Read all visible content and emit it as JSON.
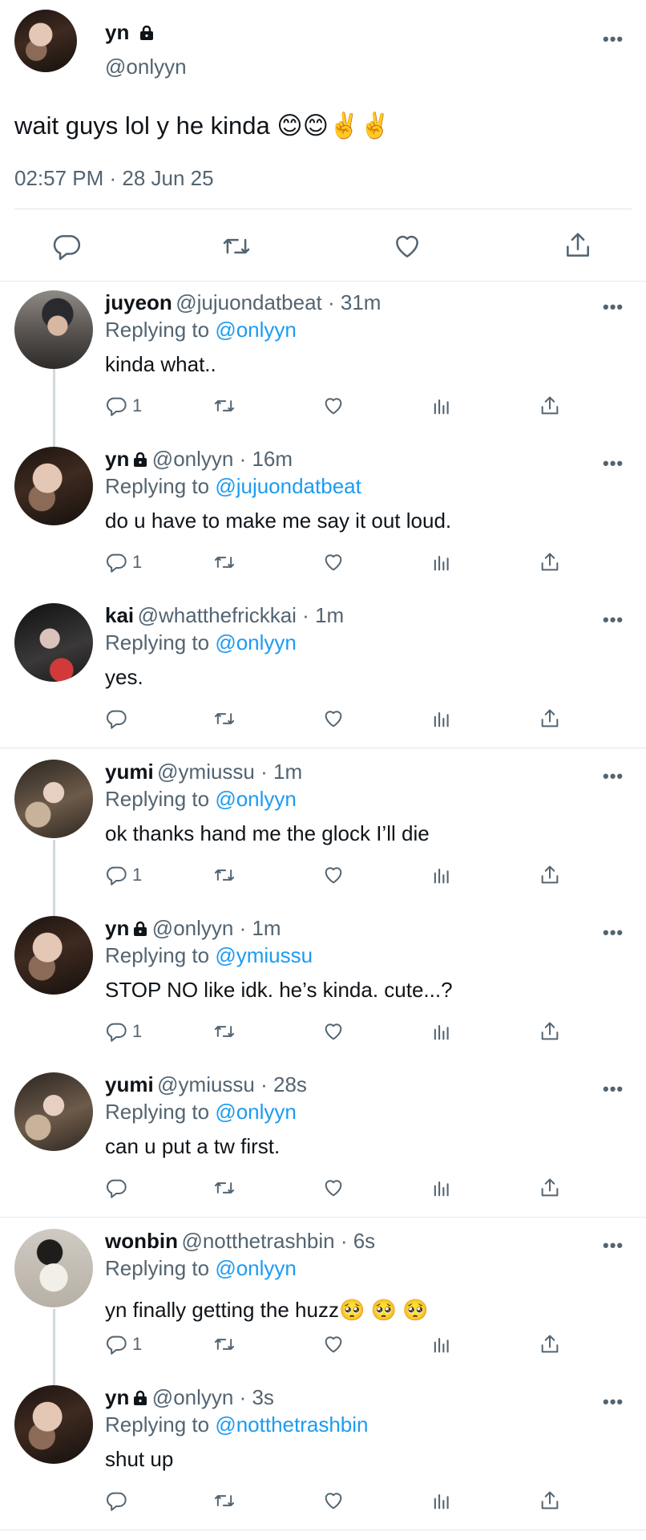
{
  "main_tweet": {
    "name": "yn",
    "handle": "@onlyyn",
    "text": "wait guys lol y he kinda 😊😊✌️✌️",
    "timestamp": "02:57 PM · 28 Jun 25",
    "more": "•••"
  },
  "replies": [
    {
      "name": "juyeon",
      "meta": "@jujuondatbeat · 31m",
      "replying_prefix": "Replying to ",
      "replying_to": "@onlyyn",
      "text": "kinda what..",
      "reply_count": "1"
    },
    {
      "name": "yn",
      "meta": "@onlyyn · 16m",
      "replying_prefix": "Replying to ",
      "replying_to": "@jujuondatbeat",
      "text": "do u have to make me say it out loud.",
      "reply_count": "1"
    },
    {
      "name": "kai",
      "meta": "@whatthefrickkai · 1m",
      "replying_prefix": "Replying to ",
      "replying_to": "@onlyyn",
      "text": "yes.",
      "reply_count": ""
    },
    {
      "name": "yumi",
      "meta": "@ymiussu · 1m",
      "replying_prefix": "Replying to ",
      "replying_to": "@onlyyn",
      "text": "ok thanks hand me the glock I’ll die",
      "reply_count": "1"
    },
    {
      "name": "yn",
      "meta": "@onlyyn · 1m",
      "replying_prefix": "Replying to ",
      "replying_to": "@ymiussu",
      "text": "STOP NO like idk. he’s kinda. cute...?",
      "reply_count": "1"
    },
    {
      "name": "yumi",
      "meta": "@ymiussu · 28s",
      "replying_prefix": "Replying to ",
      "replying_to": "@onlyyn",
      "text": "can u put a tw first.",
      "reply_count": ""
    },
    {
      "name": "wonbin",
      "meta": "@notthetrashbin · 6s",
      "replying_prefix": "Replying to ",
      "replying_to": "@onlyyn",
      "text": "yn finally getting the huzz🥺 🥺 🥺",
      "reply_count": "1"
    },
    {
      "name": "yn",
      "meta": "@onlyyn · 3s",
      "replying_prefix": "Replying to ",
      "replying_to": "@notthetrashbin",
      "text": "shut up",
      "reply_count": ""
    }
  ],
  "icons": {
    "reply": "reply-icon",
    "retweet": "retweet-icon",
    "like": "heart-icon",
    "views": "views-icon",
    "share": "share-icon",
    "lock": "lock-icon",
    "more": "more-icon"
  },
  "colors": {
    "link": "#1d9bf0",
    "muted": "#536471",
    "text": "#0f1419",
    "divider": "#e1e8ed"
  }
}
